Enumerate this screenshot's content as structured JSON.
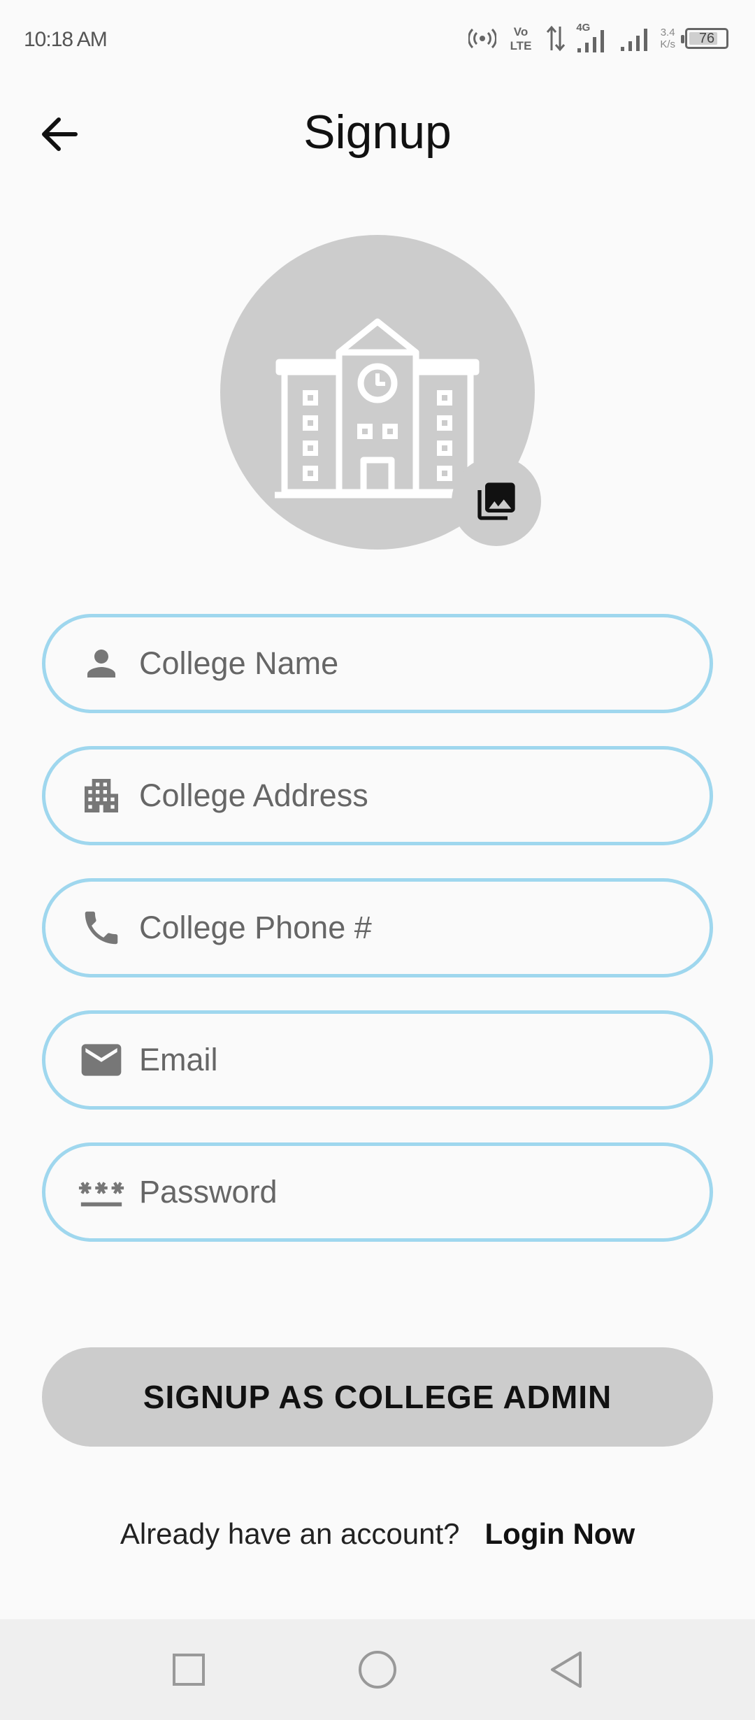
{
  "status_bar": {
    "time": "10:18 AM",
    "network_type": "4G",
    "speed_value": "3.4",
    "speed_unit": "K/s",
    "battery": "76"
  },
  "header": {
    "title": "Signup",
    "back_icon": "arrow-left-icon"
  },
  "avatar": {
    "image_icon": "college-building-icon",
    "picker_icon": "photo-library-icon",
    "background": "#cccccc"
  },
  "form": {
    "fields": [
      {
        "icon": "person-icon",
        "placeholder": "College Name"
      },
      {
        "icon": "apartment-icon",
        "placeholder": "College Address"
      },
      {
        "icon": "phone-icon",
        "placeholder": "College Phone #"
      },
      {
        "icon": "email-icon",
        "placeholder": "Email"
      },
      {
        "icon": "password-icon",
        "placeholder": "Password"
      }
    ],
    "border_color": "#9fd7ee"
  },
  "submit": {
    "label": "SIGNUP AS COLLEGE ADMIN"
  },
  "login": {
    "question": "Already have an account?",
    "link_label": "Login Now"
  },
  "nav_bar": {
    "buttons": [
      "recent-apps-icon",
      "home-icon",
      "back-icon"
    ]
  }
}
